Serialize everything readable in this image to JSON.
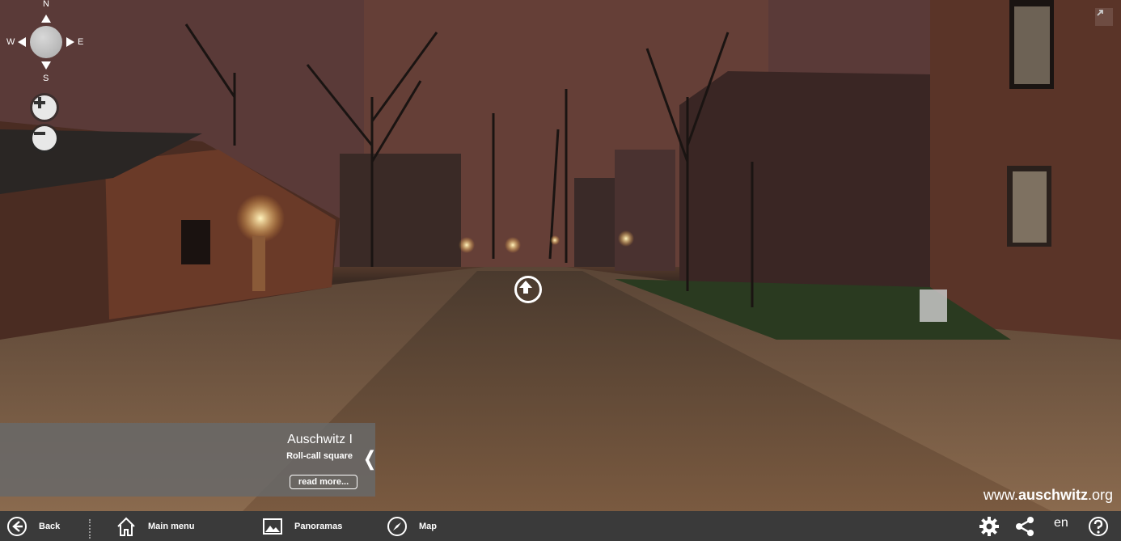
{
  "compass": {
    "north": "N",
    "south": "S",
    "east": "E",
    "west": "W"
  },
  "zoom": {
    "in_icon": "plus-icon",
    "out_icon": "minus-icon"
  },
  "fullscreen_icon": "expand-icon",
  "hotspot_icon": "arrow-up-circle-icon",
  "info_panel": {
    "title": "Auschwitz I",
    "subtitle": "Roll-call square",
    "read_more": "read more...",
    "collapse_glyph": "❬"
  },
  "watermark": {
    "prefix": "www.",
    "bold": "auschwitz",
    "suffix": ".org"
  },
  "bottom_bar": {
    "back": "Back",
    "main_menu": "Main menu",
    "panoramas": "Panoramas",
    "map": "Map",
    "language": "en"
  },
  "colors": {
    "bar": "#3a3a3a",
    "panel": "#696969",
    "accent": "#ffffff"
  }
}
